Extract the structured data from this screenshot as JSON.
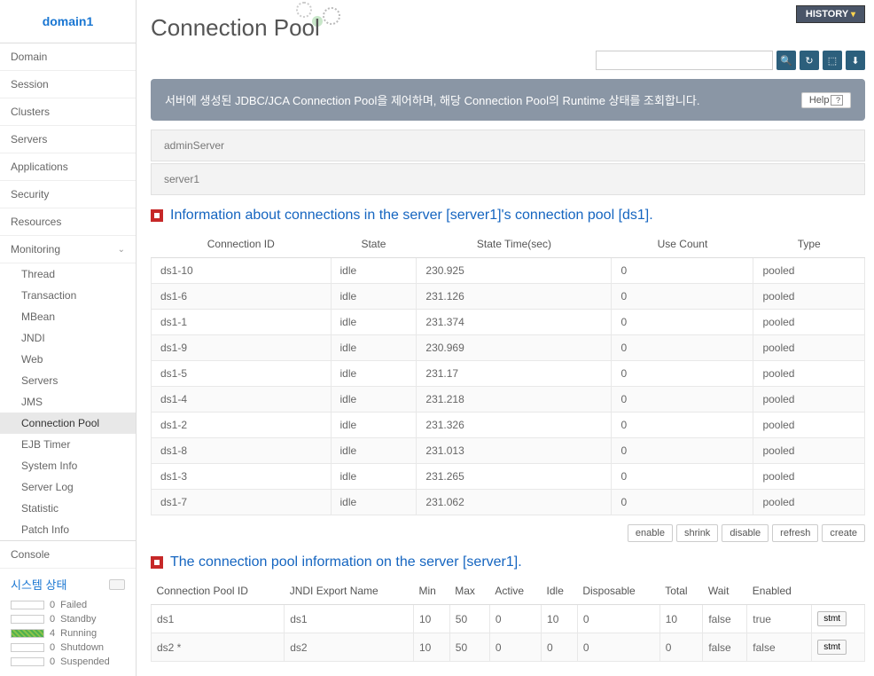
{
  "domain": "domain1",
  "page_title": "Connection Pool",
  "history_label": "HISTORY",
  "search": {
    "placeholder": ""
  },
  "banner": {
    "text": "서버에 생성된 JDBC/JCA Connection Pool을 제어하며, 해당 Connection Pool의 Runtime 상태를 조회합니다.",
    "help_label": "Help"
  },
  "sidebar": {
    "items": [
      {
        "label": "Domain"
      },
      {
        "label": "Session"
      },
      {
        "label": "Clusters"
      },
      {
        "label": "Servers"
      },
      {
        "label": "Applications"
      },
      {
        "label": "Security"
      },
      {
        "label": "Resources"
      },
      {
        "label": "Monitoring",
        "expandable": true
      }
    ],
    "sub_items": [
      {
        "label": "Thread"
      },
      {
        "label": "Transaction"
      },
      {
        "label": "MBean"
      },
      {
        "label": "JNDI"
      },
      {
        "label": "Web"
      },
      {
        "label": "Servers"
      },
      {
        "label": "JMS"
      },
      {
        "label": "Connection Pool",
        "active": true
      },
      {
        "label": "EJB Timer"
      },
      {
        "label": "System Info"
      },
      {
        "label": "Server Log"
      },
      {
        "label": "Statistic"
      },
      {
        "label": "Patch Info"
      }
    ],
    "console_label": "Console",
    "system_status": {
      "title": "시스템 상태",
      "rows": [
        {
          "count": "0",
          "label": "Failed"
        },
        {
          "count": "0",
          "label": "Standby"
        },
        {
          "count": "4",
          "label": "Running",
          "running": true
        },
        {
          "count": "0",
          "label": "Shutdown"
        },
        {
          "count": "0",
          "label": "Suspended"
        }
      ]
    }
  },
  "servers": [
    {
      "name": "adminServer"
    },
    {
      "name": "server1"
    }
  ],
  "section1": {
    "title": "Information about connections in the server [server1]'s connection pool [ds1].",
    "columns": [
      "Connection ID",
      "State",
      "State Time(sec)",
      "Use Count",
      "Type"
    ],
    "rows": [
      {
        "id": "ds1-10",
        "state": "idle",
        "time": "230.925",
        "count": "0",
        "type": "pooled"
      },
      {
        "id": "ds1-6",
        "state": "idle",
        "time": "231.126",
        "count": "0",
        "type": "pooled"
      },
      {
        "id": "ds1-1",
        "state": "idle",
        "time": "231.374",
        "count": "0",
        "type": "pooled"
      },
      {
        "id": "ds1-9",
        "state": "idle",
        "time": "230.969",
        "count": "0",
        "type": "pooled"
      },
      {
        "id": "ds1-5",
        "state": "idle",
        "time": "231.17",
        "count": "0",
        "type": "pooled"
      },
      {
        "id": "ds1-4",
        "state": "idle",
        "time": "231.218",
        "count": "0",
        "type": "pooled"
      },
      {
        "id": "ds1-2",
        "state": "idle",
        "time": "231.326",
        "count": "0",
        "type": "pooled"
      },
      {
        "id": "ds1-8",
        "state": "idle",
        "time": "231.013",
        "count": "0",
        "type": "pooled"
      },
      {
        "id": "ds1-3",
        "state": "idle",
        "time": "231.265",
        "count": "0",
        "type": "pooled"
      },
      {
        "id": "ds1-7",
        "state": "idle",
        "time": "231.062",
        "count": "0",
        "type": "pooled"
      }
    ]
  },
  "actions": {
    "buttons": [
      "enable",
      "shrink",
      "disable",
      "refresh",
      "create"
    ]
  },
  "section2": {
    "title": "The connection pool information on the server [server1].",
    "columns": [
      "Connection Pool ID",
      "JNDI Export Name",
      "Min",
      "Max",
      "Active",
      "Idle",
      "Disposable",
      "Total",
      "Wait",
      "Enabled",
      ""
    ],
    "rows": [
      {
        "pool_id": "ds1",
        "jndi": "ds1",
        "min": "10",
        "max": "50",
        "active": "0",
        "idle": "10",
        "disposable": "0",
        "total": "10",
        "wait": "false",
        "enabled": "true",
        "stmt": "stmt"
      },
      {
        "pool_id": "ds2 *",
        "jndi": "ds2",
        "min": "10",
        "max": "50",
        "active": "0",
        "idle": "0",
        "disposable": "0",
        "total": "0",
        "wait": "false",
        "enabled": "false",
        "stmt": "stmt"
      }
    ]
  }
}
